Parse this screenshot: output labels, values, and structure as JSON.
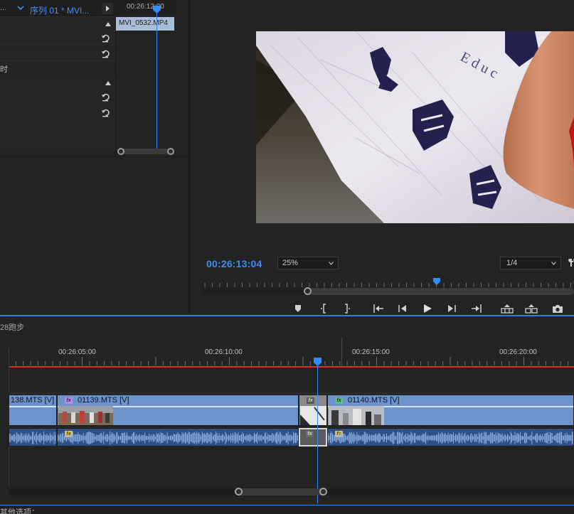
{
  "effect_controls": {
    "tab_ellipsis": "...",
    "sequence_title": "序列 01 * MVI...",
    "partial_label": "时",
    "ruler_time": "00:26:12:00",
    "clip_name": "MVI_0532.MP4"
  },
  "program_monitor": {
    "timecode": "00:26:13:04",
    "zoom": "25%",
    "resolution": "1/4",
    "playhead_position_fraction": 0.62,
    "transport_buttons": [
      "add-marker",
      "mark-in",
      "mark-out",
      "go-to-in",
      "step-back",
      "play",
      "step-forward",
      "go-to-out",
      "lift",
      "extract",
      "export-frame"
    ]
  },
  "timeline": {
    "title": "28跑步",
    "times": [
      "00:26:05:00",
      "00:26:10:00",
      "00:26:15:00",
      "00:26:20:00"
    ],
    "clips_video": [
      {
        "label": "138.MTS [V]"
      },
      {
        "label": "01139.MTS [V]"
      },
      {
        "label": "01140.MTS [V]"
      }
    ],
    "fx_badge": "fx",
    "colors": {
      "video_clip": "#6e93cc",
      "audio_clip": "#2f4f85",
      "playhead": "#2f8dff",
      "work_area": "#d9302f",
      "timecode": "#3a8ff5"
    }
  },
  "status": {
    "bottom_text": "其他选项："
  }
}
